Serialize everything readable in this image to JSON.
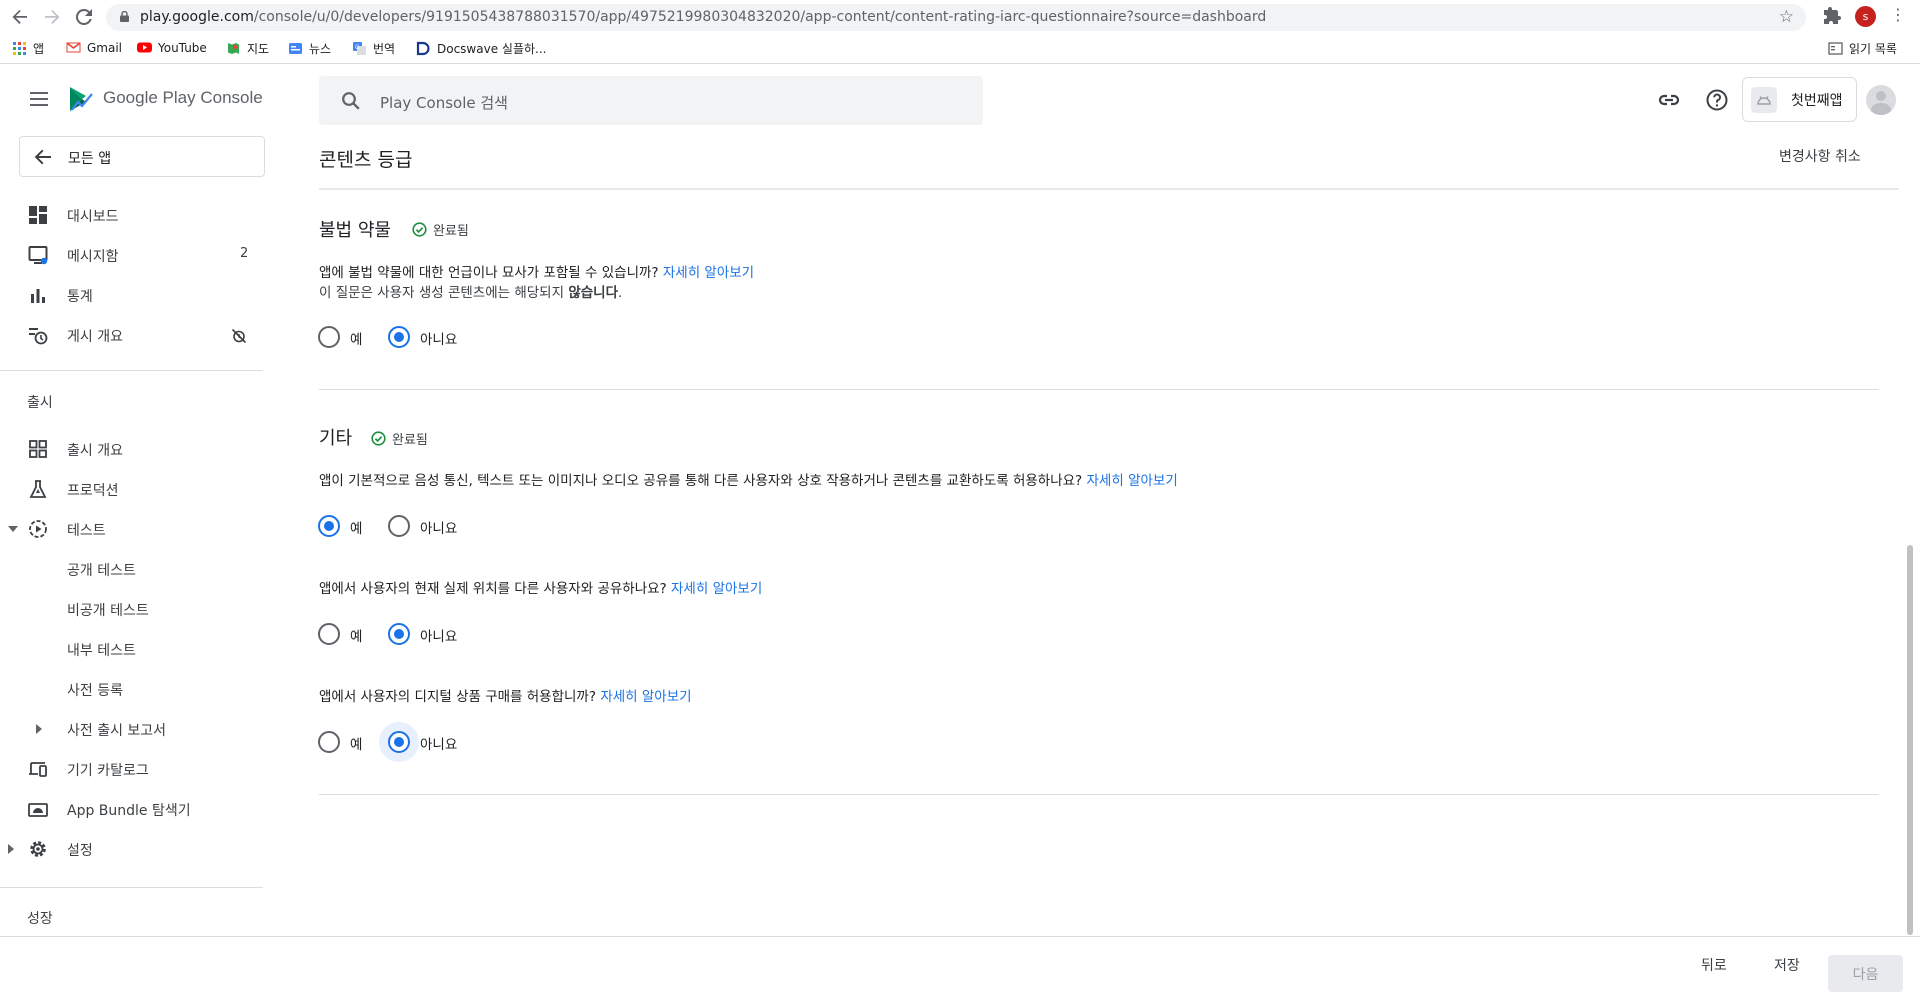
{
  "browser": {
    "url_host": "play.google.com",
    "url_path": "/console/u/0/developers/9191505438788031570/app/4975219980304832020/app-content/content-rating-iarc-questionnaire?source=dashboard",
    "profile_initial": "s",
    "bookmarks": [
      "앱",
      "Gmail",
      "YouTube",
      "지도",
      "뉴스",
      "번역",
      "Docswave 실플하...",
      "읽기 목록"
    ]
  },
  "header": {
    "brand": "Google Play Console",
    "search_placeholder": "Play Console 검색",
    "app_name": "첫번째앱"
  },
  "sidebar": {
    "back_label": "모든 앱",
    "items_top": [
      {
        "label": "대시보드"
      },
      {
        "label": "메시지함",
        "count": "2"
      },
      {
        "label": "통계"
      },
      {
        "label": "게시 개요"
      }
    ],
    "section_release": "출시",
    "items_release": [
      {
        "label": "출시 개요"
      },
      {
        "label": "프로덕션"
      },
      {
        "label": "테스트"
      },
      {
        "label": "공개 테스트"
      },
      {
        "label": "비공개 테스트"
      },
      {
        "label": "내부 테스트"
      },
      {
        "label": "사전 등록"
      },
      {
        "label": "사전 출시 보고서"
      },
      {
        "label": "기기 카탈로그"
      },
      {
        "label": "App Bundle 탐색기"
      },
      {
        "label": "설정"
      }
    ],
    "section_growth": "성장"
  },
  "main": {
    "page_title": "콘텐츠 등급",
    "discard_label": "변경사항 취소",
    "sections": [
      {
        "title": "불법 약물",
        "status": "완료됨",
        "question": "앱에 불법 약물에 대한 언급이나 묘사가 포함될 수 있습니까?",
        "link": "자세히 알아보기",
        "note_prefix": "이 질문은 사용자 생성 콘텐츠에는 해당되지 ",
        "note_bold": "않습니다",
        "note_suffix": ".",
        "answer": "아니요"
      },
      {
        "title": "기타",
        "status": "완료됨",
        "questions": [
          {
            "text": "앱이 기본적으로 음성 통신, 텍스트 또는 이미지나 오디오 공유를 통해 다른 사용자와 상호 작용하거나 콘텐츠를 교환하도록 허용하나요?",
            "link": "자세히 알아보기",
            "answer": "예"
          },
          {
            "text": "앱에서 사용자의 현재 실제 위치를 다른 사용자와 공유하나요?",
            "link": "자세히 알아보기",
            "answer": "아니요"
          },
          {
            "text": "앱에서 사용자의 디지털 상품 구매를 허용합니까?",
            "link": "자세히 알아보기",
            "answer": "아니요"
          }
        ]
      }
    ],
    "option_yes": "예",
    "option_no": "아니요"
  },
  "bottom_bar": {
    "back": "뒤로",
    "save": "저장",
    "next": "다음"
  },
  "colors": {
    "accent": "#1a73e8",
    "success": "#1e8e3e",
    "text": "#202124"
  }
}
